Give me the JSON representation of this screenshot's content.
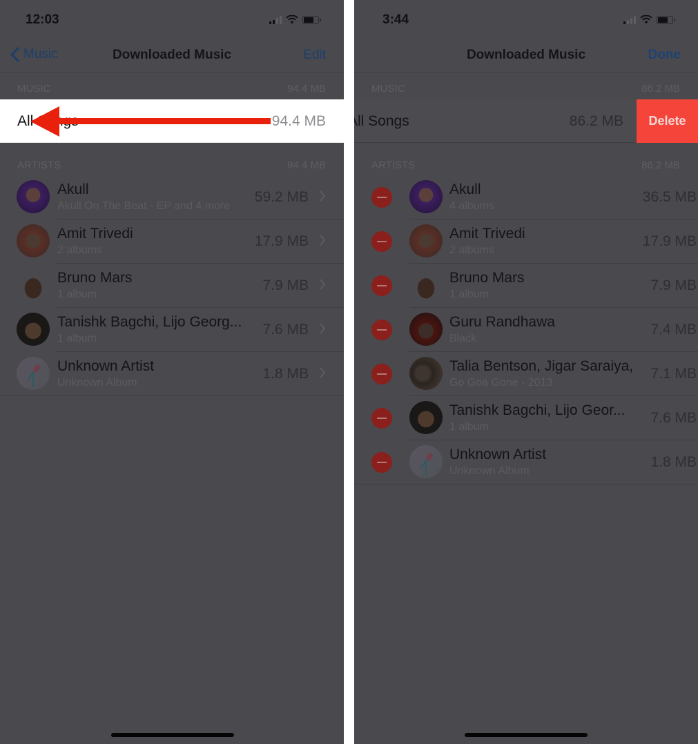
{
  "left": {
    "status": {
      "time": "12:03"
    },
    "nav": {
      "back_label": "Music",
      "title": "Downloaded Music",
      "right_label": "Edit"
    },
    "music_section": {
      "label": "MUSIC",
      "size": "94.4 MB"
    },
    "all_songs": {
      "label": "All Songs",
      "size": "94.4 MB"
    },
    "artists_section": {
      "label": "ARTISTS",
      "size": "94.4 MB"
    },
    "artists": [
      {
        "name": "Akull",
        "subtitle": "Akull On The Beat - EP and 4 more",
        "size": "59.2 MB",
        "avatar": "purple"
      },
      {
        "name": "Amit Trivedi",
        "subtitle": "2 albums",
        "size": "17.9 MB",
        "avatar": "brown"
      },
      {
        "name": "Bruno Mars",
        "subtitle": "1 album",
        "size": "7.9 MB",
        "avatar": "figure"
      },
      {
        "name": "Tanishk Bagchi, Lijo Georg...",
        "subtitle": "1 album",
        "size": "7.6 MB",
        "avatar": "dark"
      },
      {
        "name": "Unknown Artist",
        "subtitle": "Unknown Album",
        "size": "1.8 MB",
        "avatar": "microphone"
      }
    ],
    "annotation": "red-arrow-swipe-left"
  },
  "right": {
    "status": {
      "time": "3:44"
    },
    "nav": {
      "title": "Downloaded Music",
      "right_label": "Done"
    },
    "music_section": {
      "label": "MUSIC",
      "size": "86.2 MB"
    },
    "all_songs": {
      "label": "All Songs",
      "size": "86.2 MB",
      "delete_label": "Delete"
    },
    "artists_section": {
      "label": "ARTISTS",
      "size": "86.2 MB"
    },
    "artists": [
      {
        "name": "Akull",
        "subtitle": "4 albums",
        "size": "36.5 MB",
        "avatar": "purple"
      },
      {
        "name": "Amit Trivedi",
        "subtitle": "2 albums",
        "size": "17.9 MB",
        "avatar": "brown"
      },
      {
        "name": "Bruno Mars",
        "subtitle": "1 album",
        "size": "7.9 MB",
        "avatar": "figure"
      },
      {
        "name": "Guru Randhawa",
        "subtitle": "Black",
        "size": "7.4 MB",
        "avatar": "red-dark"
      },
      {
        "name": "Talia Bentson, Jigar Saraiya,",
        "subtitle": "Go Goa Gone - 2013",
        "size": "7.1 MB",
        "avatar": "group"
      },
      {
        "name": "Tanishk Bagchi, Lijo Geor...",
        "subtitle": "1 album",
        "size": "7.6 MB",
        "avatar": "dark"
      },
      {
        "name": "Unknown Artist",
        "subtitle": "Unknown Album",
        "size": "1.8 MB",
        "avatar": "microphone"
      }
    ]
  },
  "colors": {
    "overlay_bg": "#4a494e",
    "delete_red": "#f5453a",
    "arrow_red": "#e8200c",
    "link_blue": "#1c3f6a"
  }
}
